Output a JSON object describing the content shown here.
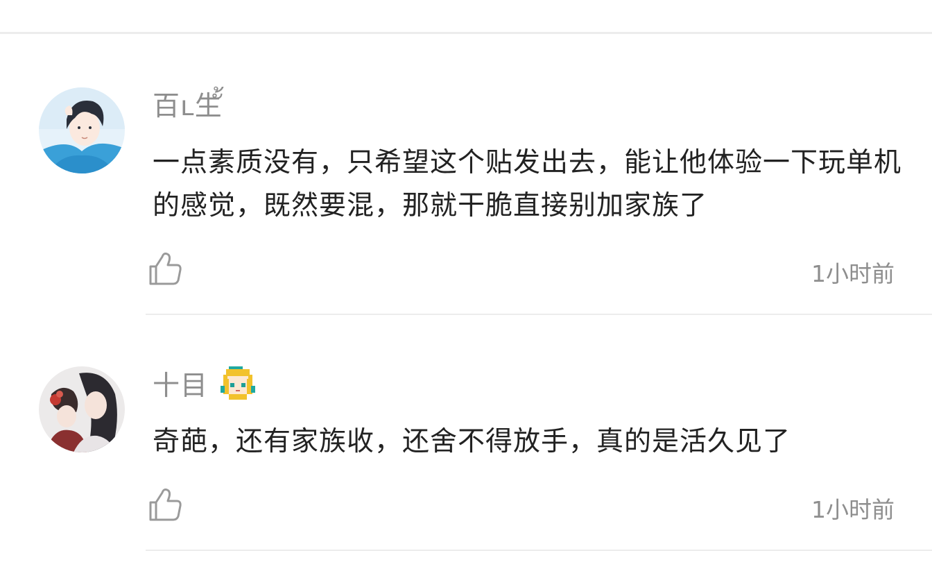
{
  "comments": [
    {
      "username": "百ʟ生ั้",
      "text": "一点素质没有，只希望这个贴发出去，能让他体验一下玩单机的感觉，既然要混，那就干脆直接别加家族了",
      "time": "1小时前",
      "avatar_icon": "anime-boy-avatar",
      "like_icon": "thumbs-up-icon"
    },
    {
      "username": "十目",
      "text": "奇葩，还有家族收，还舍不得放手，真的是活久见了",
      "time": "1小时前",
      "avatar_icon": "anime-couple-avatar",
      "badge_icon": "pixel-character-badge",
      "like_icon": "thumbs-up-icon"
    }
  ],
  "colors": {
    "username": "#8e8e8e",
    "text": "#222222",
    "timestamp": "#8e8e8e",
    "divider": "#ececec",
    "icon": "#9a9a9a"
  }
}
